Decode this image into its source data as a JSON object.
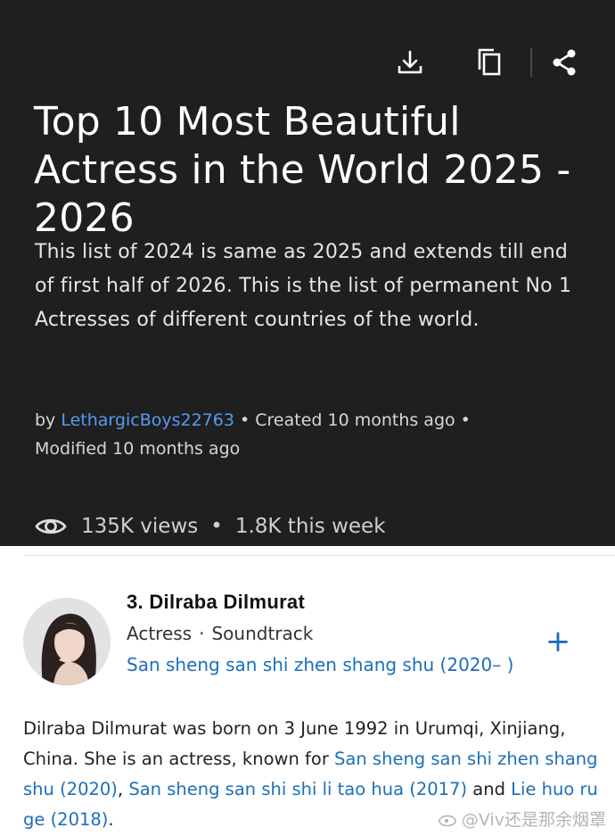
{
  "toolbar": {
    "download_icon": "download-icon",
    "copy_icon": "copy-icon",
    "share_icon": "share-icon"
  },
  "header": {
    "title": "Top 10 Most Beautiful Actress in the World 2025 - 2026",
    "description": "This list of 2024 is same as 2025 and extends till end of first half of 2026. This is the list of permanent No 1 Actresses of different countries of the world."
  },
  "meta": {
    "by": "by",
    "author": "LethargicBoys22763",
    "created": "• Created 10 months ago •",
    "modified": "Modified 10 months ago"
  },
  "stats": {
    "views": "135K views",
    "separator": "•",
    "weekly": "1.8K this week"
  },
  "item": {
    "title": "3. Dilraba Dilmurat",
    "role1": "Actress",
    "role_separator": "·",
    "role2": "Soundtrack",
    "known_for": "San sheng san shi zhen shang shu (2020– )",
    "bio_prefix": "Dilraba Dilmurat was born on 3 June 1992 in Urumqi, Xinjiang, China. She is an actress, known for",
    "bio_link1": "San sheng san shi zhen shang shu (2020)",
    "bio_comma": ",",
    "bio_link2": "San sheng san shi shi li tao hua (2017)",
    "bio_and": "and",
    "bio_link3": "Lie huo ru ge (2018)",
    "bio_end": "."
  },
  "watermark": "@Viv还是那余烟罩",
  "colors": {
    "dark_bg": "#1f1f1f",
    "link": "#1c6fb8",
    "author_link": "#5799ef"
  }
}
